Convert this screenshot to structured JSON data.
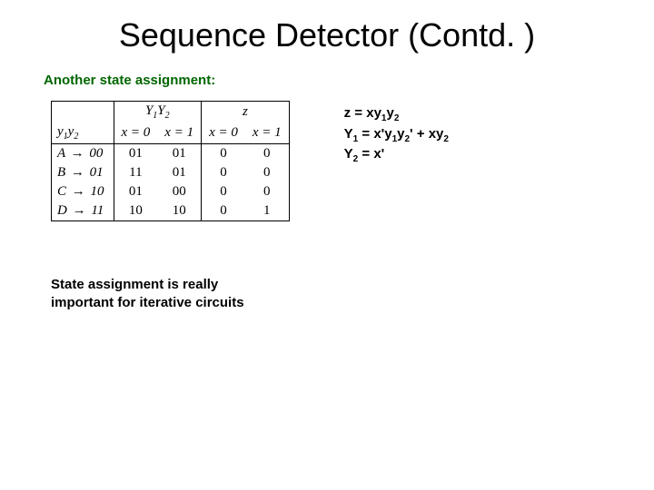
{
  "title": "Sequence Detector (Contd. )",
  "subtitle": "Another state assignment:",
  "table": {
    "top_header": {
      "y_group": "Y",
      "z_group": "z"
    },
    "corner_label": "y",
    "sub1": "1",
    "sub2": "2",
    "x0": "x = 0",
    "x1": "x = 1",
    "rows": [
      {
        "state": "A",
        "code": "00",
        "y_x0": "01",
        "y_x1": "01",
        "z_x0": "0",
        "z_x1": "0"
      },
      {
        "state": "B",
        "code": "01",
        "y_x0": "11",
        "y_x1": "01",
        "z_x0": "0",
        "z_x1": "0"
      },
      {
        "state": "C",
        "code": "10",
        "y_x0": "01",
        "y_x1": "00",
        "z_x0": "0",
        "z_x1": "0"
      },
      {
        "state": "D",
        "code": "11",
        "y_x0": "10",
        "y_x1": "10",
        "z_x0": "0",
        "z_x1": "1"
      }
    ]
  },
  "equations": {
    "z": "z = xy",
    "z_sub1": "1",
    "z_mid": "y",
    "z_sub2": "2",
    "Y1": "Y",
    "Y1_sub": "1",
    "Y1_rhs_a": " = x'y",
    "Y1_rhs_b": "y",
    "Y1_rhs_c": "' + xy",
    "Y2": "Y",
    "Y2_sub": "2",
    "Y2_rhs": " = x'"
  },
  "note_line1": "State assignment is really",
  "note_line2": "important for iterative circuits"
}
